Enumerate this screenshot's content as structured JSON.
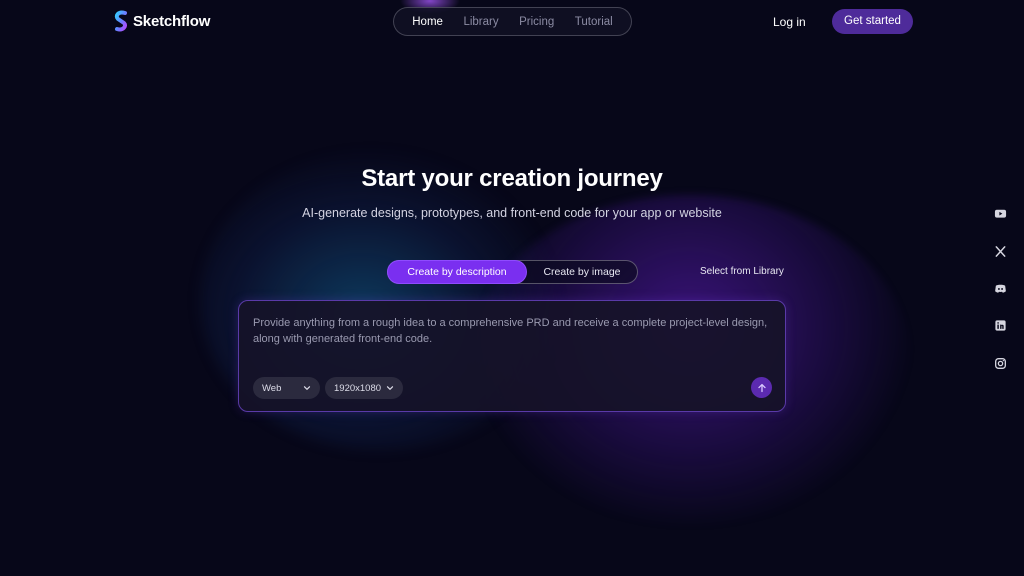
{
  "brand": {
    "name": "Sketchflow"
  },
  "nav": {
    "items": [
      {
        "label": "Home",
        "active": true
      },
      {
        "label": "Library",
        "active": false
      },
      {
        "label": "Pricing",
        "active": false
      },
      {
        "label": "Tutorial",
        "active": false
      }
    ]
  },
  "header": {
    "login_label": "Log in",
    "cta_label": "Get started"
  },
  "hero": {
    "title": "Start your creation journey",
    "subtitle": "AI-generate designs, prototypes, and front-end code for your app or website"
  },
  "modes": {
    "by_description": "Create by description",
    "by_image": "Create by image",
    "library_link": "Select from Library"
  },
  "prompt": {
    "placeholder": "Provide anything from a rough idea to a comprehensive PRD and receive a complete project-level design, along with generated front-end code.",
    "platform_value": "Web",
    "size_value": "1920x1080"
  },
  "social": [
    "youtube-icon",
    "x-icon",
    "discord-icon",
    "linkedin-icon",
    "instagram-icon"
  ],
  "colors": {
    "background": "#070719",
    "accent": "#7a2ff0",
    "cta": "#4e2b9a"
  }
}
